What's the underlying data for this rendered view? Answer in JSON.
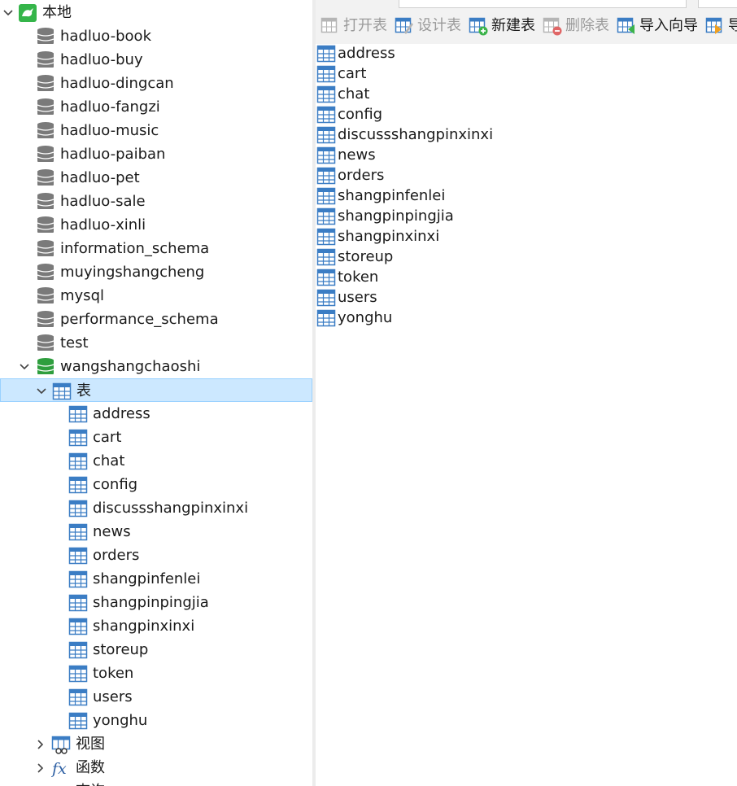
{
  "tree": {
    "root": {
      "label": "本地"
    },
    "databases": [
      "hadluo-book",
      "hadluo-buy",
      "hadluo-dingcan",
      "hadluo-fangzi",
      "hadluo-music",
      "hadluo-paiban",
      "hadluo-pet",
      "hadluo-sale",
      "hadluo-xinli",
      "information_schema",
      "muyingshangcheng",
      "mysql",
      "performance_schema",
      "test"
    ],
    "active_database": {
      "label": "wangshangchaoshi"
    },
    "tables_folder": {
      "label": "表"
    },
    "tables": [
      "address",
      "cart",
      "chat",
      "config",
      "discussshangpinxinxi",
      "news",
      "orders",
      "shangpinfenlei",
      "shangpinpingjia",
      "shangpinxinxi",
      "storeup",
      "token",
      "users",
      "yonghu"
    ],
    "views_folder": {
      "label": "视图"
    },
    "functions_folder": {
      "label": "函数"
    },
    "queries_folder": {
      "label": "查询"
    }
  },
  "toolbar": {
    "open_table": "打开表",
    "design_table": "设计表",
    "new_table": "新建表",
    "delete_table": "删除表",
    "import_wizard": "导入向导",
    "export_wizard": "导"
  },
  "object_list": [
    "address",
    "cart",
    "chat",
    "config",
    "discussshangpinxinxi",
    "news",
    "orders",
    "shangpinfenlei",
    "shangpinpingjia",
    "shangpinxinxi",
    "storeup",
    "token",
    "users",
    "yonghu"
  ],
  "colors": {
    "selection_bg": "#cce8ff",
    "selection_border": "#99d1ff",
    "db_icon": "#7a7a7a",
    "db_icon_active": "#2e9e3e",
    "table_icon": "#3b7dc4",
    "connection_icon": "#35b54a"
  }
}
